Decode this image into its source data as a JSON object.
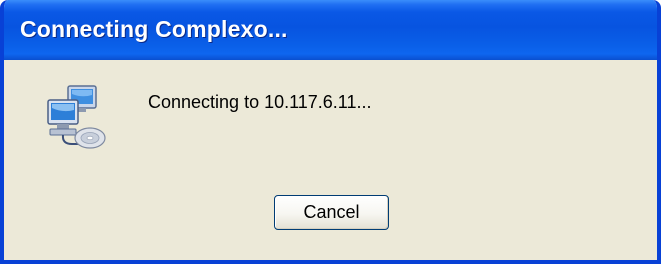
{
  "window": {
    "title": "Connecting Complexo...",
    "title_color": "#ffffff",
    "titlebar_color": "#0754e0",
    "border_color": "#0841d6",
    "body_color": "#ece9d8"
  },
  "dialog": {
    "icon": "network-connection-icon",
    "message": "Connecting to 10.117.6.11...",
    "cancel_label": "Cancel"
  }
}
